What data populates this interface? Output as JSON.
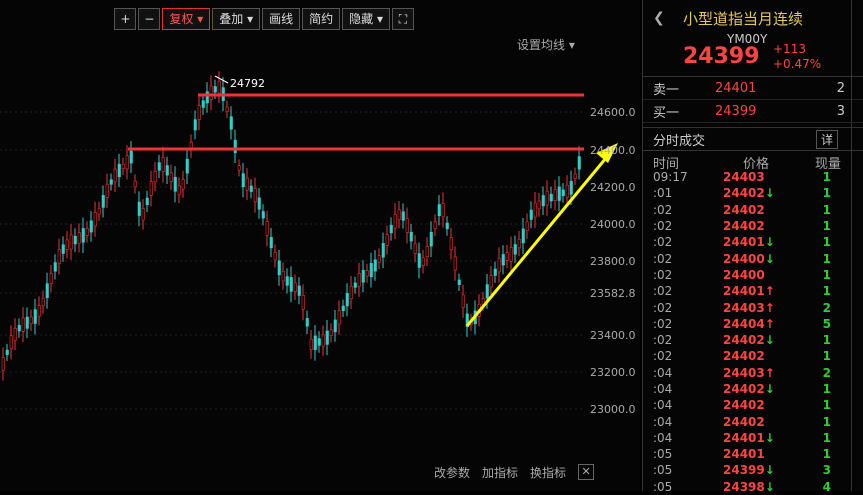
{
  "toolbar": {
    "plus": "+",
    "minus": "−",
    "fuquan": "复权",
    "overlay": "叠加",
    "draw": "画线",
    "simple": "简约",
    "hide": "隐藏",
    "fullscreen_icon": "expand-icon"
  },
  "ma_setting": "设置均线",
  "price_axis": [
    "24600.0",
    "24400.0",
    "24200.0",
    "24000.0",
    "23800.0",
    "23582.8",
    "23400.0",
    "23200.0",
    "23000.0"
  ],
  "high_label": "24792",
  "bottom_bar": {
    "params": "改参数",
    "add": "加指标",
    "swap": "换指标",
    "close": "✕"
  },
  "panel": {
    "title": "小型道指当月连续",
    "code": "YM00Y",
    "price": "24399",
    "change": "+113",
    "change_pct": "+0.47%",
    "sell_label": "卖一",
    "sell_price": "24401",
    "sell_qty": "2",
    "buy_label": "买一",
    "buy_price": "24399",
    "buy_qty": "3",
    "trades_title": "分时成交",
    "detail": "详",
    "cols": [
      "时间",
      "价格",
      "现量"
    ],
    "trades": [
      {
        "t": "09:17",
        "p": "24403",
        "a": "",
        "v": "1"
      },
      {
        "t": ":01",
        "p": "24402",
        "a": "down",
        "v": "1"
      },
      {
        "t": ":02",
        "p": "24402",
        "a": "",
        "v": "1"
      },
      {
        "t": ":02",
        "p": "24402",
        "a": "",
        "v": "1"
      },
      {
        "t": ":02",
        "p": "24401",
        "a": "down",
        "v": "1"
      },
      {
        "t": ":02",
        "p": "24400",
        "a": "down",
        "v": "1"
      },
      {
        "t": ":02",
        "p": "24400",
        "a": "",
        "v": "1"
      },
      {
        "t": ":02",
        "p": "24401",
        "a": "up",
        "v": "1"
      },
      {
        "t": ":02",
        "p": "24403",
        "a": "up",
        "v": "2"
      },
      {
        "t": ":02",
        "p": "24404",
        "a": "up",
        "v": "5"
      },
      {
        "t": ":02",
        "p": "24402",
        "a": "down",
        "v": "1"
      },
      {
        "t": ":02",
        "p": "24402",
        "a": "",
        "v": "1"
      },
      {
        "t": ":04",
        "p": "24403",
        "a": "up",
        "v": "2"
      },
      {
        "t": ":04",
        "p": "24402",
        "a": "down",
        "v": "1"
      },
      {
        "t": ":04",
        "p": "24402",
        "a": "",
        "v": "1"
      },
      {
        "t": ":04",
        "p": "24402",
        "a": "",
        "v": "1"
      },
      {
        "t": ":04",
        "p": "24401",
        "a": "down",
        "v": "1"
      },
      {
        "t": ":05",
        "p": "24401",
        "a": "",
        "v": "1"
      },
      {
        "t": ":05",
        "p": "24399",
        "a": "down",
        "v": "3"
      },
      {
        "t": ":05",
        "p": "24398",
        "a": "down",
        "v": "4"
      }
    ]
  },
  "colors": {
    "up": "#ff4444",
    "down": "#33cc33",
    "support": "#ffff00"
  }
}
